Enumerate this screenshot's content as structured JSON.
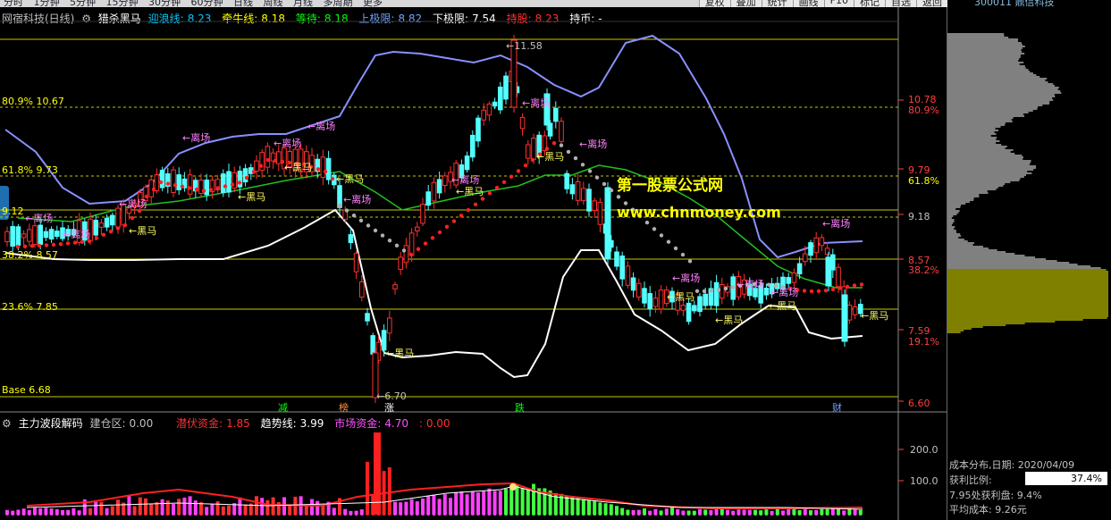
{
  "toolbar": {
    "periods": [
      "分时",
      "1分钟",
      "5分钟",
      "15分钟",
      "30分钟",
      "60分钟",
      "日线",
      "周线",
      "月线",
      "多周期",
      "更多"
    ],
    "buttons": [
      "复权",
      "叠加",
      "统计",
      "画线",
      "F10",
      "标记",
      "自选",
      "返回"
    ],
    "right_title": "300011 鼎信科技"
  },
  "main_legend": {
    "stock": "网宿科技(日线)",
    "indicator": "猎杀黑马",
    "items": [
      {
        "label": "迎浪线:",
        "value": "8.23",
        "color": "#00c8ff"
      },
      {
        "label": "牵牛线:",
        "value": "8.18",
        "color": "#ffff00"
      },
      {
        "label": "等待:",
        "value": "8.18",
        "color": "#00ff00"
      },
      {
        "label": "上极限:",
        "value": "8.82",
        "color": "#6fa0ff"
      },
      {
        "label": "下极限:",
        "value": "7.54",
        "color": "#ffffff"
      },
      {
        "label": "持股:",
        "value": "8.23",
        "color": "#ff3030"
      },
      {
        "label": "持币:",
        "value": "-",
        "color": "#ffffff"
      }
    ]
  },
  "left_levels": [
    "80.9% 10.67",
    "61.8% 9.73",
    "9.12",
    "38.2% 8.57",
    "23.6% 7.85",
    "Base 6.68"
  ],
  "right_axis": [
    {
      "text": "10.78",
      "color": "#ff4040"
    },
    {
      "text": "80.9%",
      "color": "#ff4040"
    },
    {
      "text": "9.79",
      "color": "#ff4040"
    },
    {
      "text": "61.8%",
      "color": "#ffff00"
    },
    {
      "text": "9.18",
      "color": "#c0c0c0"
    },
    {
      "text": "8.57",
      "color": "#ff4040"
    },
    {
      "text": "38.2%",
      "color": "#ff4040"
    },
    {
      "text": "7.59",
      "color": "#ff4040"
    },
    {
      "text": "19.1%",
      "color": "#ff4040"
    },
    {
      "text": "6.60",
      "color": "#ff4040"
    }
  ],
  "price_marks": {
    "high": "11.58",
    "low": "6.70"
  },
  "watermark": {
    "line1": "第一股票公式网",
    "line2": "www.chnmoney.com"
  },
  "signals": {
    "exit": "←离场",
    "horse": "←黑马"
  },
  "event_labels": [
    "减",
    "榜",
    "涨",
    "跌",
    "财"
  ],
  "sub_legend": {
    "name": "主力波段解码",
    "items": [
      {
        "label": "建仓区:",
        "value": "0.00",
        "color": "#c0c0c0"
      },
      {
        "label": "潜伏资金:",
        "value": "1.85",
        "color": "#ff3030"
      },
      {
        "label": "趋势线:",
        "value": "3.99",
        "color": "#ffffff"
      },
      {
        "label": "市场资金:",
        "value": "4.70",
        "color": "#ff50ff"
      },
      {
        "label": ":",
        "value": "0.00",
        "color": "#ff3030"
      }
    ]
  },
  "sub_axis": [
    "200.0",
    "100.0"
  ],
  "cost_panel": {
    "title": "成本分布,日期:",
    "date": "2020/04/09",
    "profit_label": "获利比例:",
    "profit_value": "37.4%",
    "line2": "7.95处获利盘: 9.4%",
    "line3": "平均成本: 9.26元"
  }
}
